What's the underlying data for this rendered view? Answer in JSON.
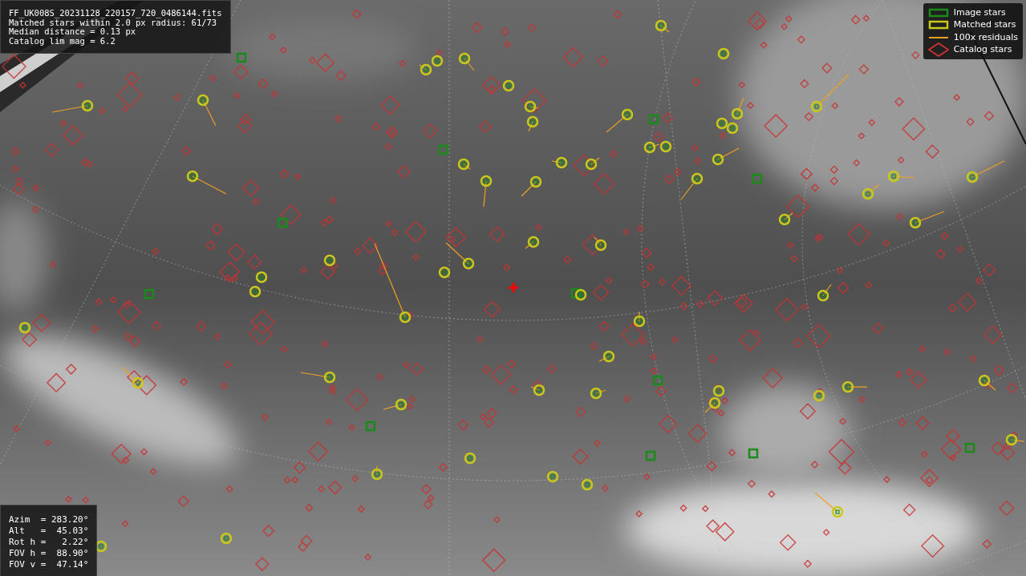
{
  "info_box": {
    "lines": [
      "FF_UK008S_20231128_220157_720_0486144.fits",
      "Matched stars within 2.0 px radius: 61/73",
      "Median distance = 0.13 px",
      "Catalog lim mag = 6.2"
    ]
  },
  "legend": {
    "items": [
      {
        "label": "Image stars",
        "kind": "box",
        "color": "#1a8a1a"
      },
      {
        "label": "Matched stars",
        "kind": "box",
        "color": "#c8c81a"
      },
      {
        "label": "100x residuals",
        "kind": "line",
        "color": "#f0a020"
      },
      {
        "label": "Catalog stars",
        "kind": "diamond",
        "color": "#c83232"
      }
    ]
  },
  "pointing_box": {
    "lines": [
      "Azim  = 283.20°",
      "Alt   =  45.03°",
      "Rot h =   2.22°",
      "FOV h =  88.90°",
      "FOV v =  47.14°"
    ]
  }
}
